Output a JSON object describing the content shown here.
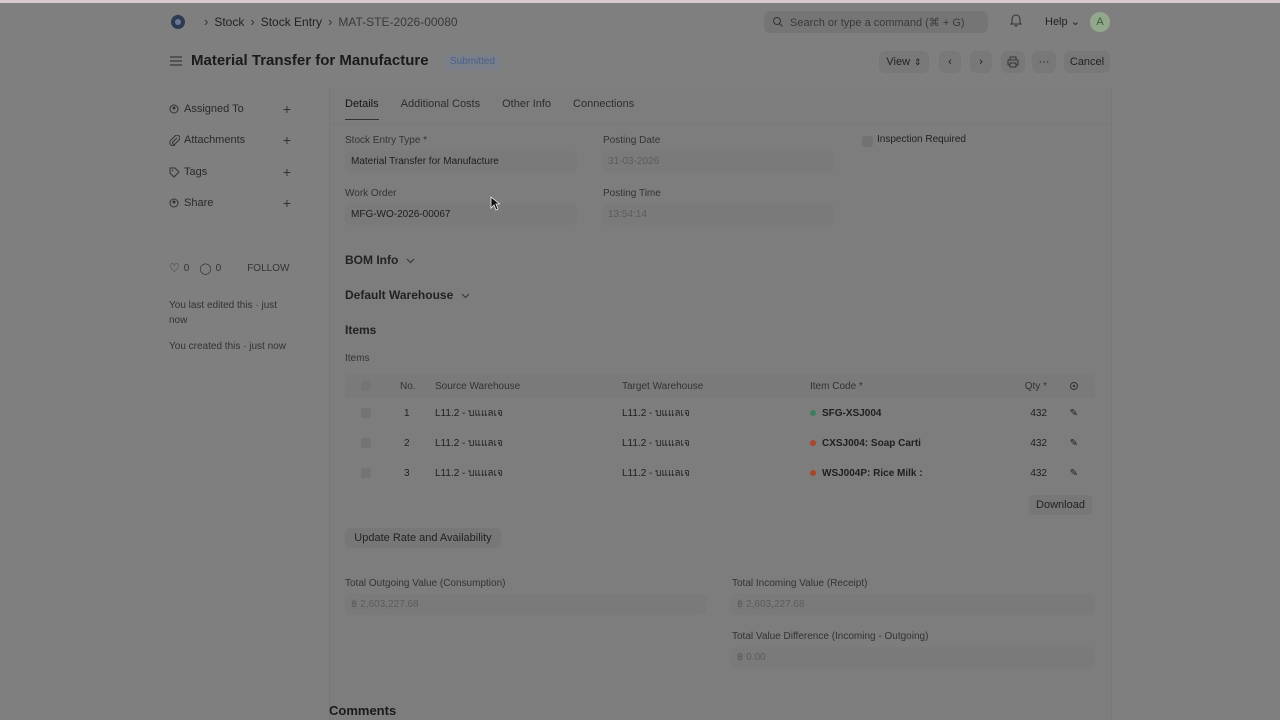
{
  "navbar": {
    "breadcrumbs": [
      "Stock",
      "Stock Entry",
      "MAT-STE-2026-00080"
    ],
    "search_placeholder": "Search or type a command (⌘ + G)",
    "help_label": "Help",
    "avatar_initial": "A"
  },
  "header": {
    "title": "Material Transfer for Manufacture",
    "status": "Submitted",
    "view_label": "View",
    "more_label": "···",
    "cancel_label": "Cancel"
  },
  "sidebar": {
    "items": [
      {
        "label": "Assigned To",
        "icon": "assign-icon"
      },
      {
        "label": "Attachments",
        "icon": "paperclip-icon"
      },
      {
        "label": "Tags",
        "icon": "tag-icon"
      },
      {
        "label": "Share",
        "icon": "share-icon"
      }
    ],
    "likes": "0",
    "comments": "0",
    "follow_label": "FOLLOW",
    "last_edited": "You last edited this · just now",
    "created": "You created this · just now"
  },
  "tabs": [
    "Details",
    "Additional Costs",
    "Other Info",
    "Connections"
  ],
  "form": {
    "stock_entry_type_label": "Stock Entry Type *",
    "stock_entry_type": "Material Transfer for Manufacture",
    "posting_date_label": "Posting Date",
    "posting_date": "31-03-2026",
    "inspection_label": "Inspection Required",
    "work_order_label": "Work Order",
    "work_order": "MFG-WO-2026-00067",
    "posting_time_label": "Posting Time",
    "posting_time": "13:54:14"
  },
  "sections": {
    "bom_info": "BOM Info",
    "default_warehouse": "Default Warehouse",
    "items": "Items",
    "items_sub": "Items"
  },
  "table": {
    "headers": {
      "no": "No.",
      "source": "Source Warehouse",
      "target": "Target Warehouse",
      "item_code": "Item Code *",
      "qty": "Qty *"
    },
    "rows": [
      {
        "no": "1",
        "source": "L11.2 - บแแลเจ",
        "target": "L11.2 - บแแลเจ",
        "item_code": "SFG-XSJ004",
        "dot": "#3f7d5a",
        "qty": "432"
      },
      {
        "no": "2",
        "source": "L11.2 - บแแลเจ",
        "target": "L11.2 - บแแลเจ",
        "item_code": "CXSJ004: Soap Carti",
        "dot": "#a8462a",
        "qty": "432"
      },
      {
        "no": "3",
        "source": "L11.2 - บแแลเจ",
        "target": "L11.2 - บแแลเจ",
        "item_code": "WSJ004P: Rice Milk :",
        "dot": "#a8462a",
        "qty": "432"
      }
    ],
    "download_label": "Download"
  },
  "update_rate_label": "Update Rate and Availability",
  "totals": {
    "outgoing_label": "Total Outgoing Value (Consumption)",
    "outgoing": "฿ 2,603,227.68",
    "incoming_label": "Total Incoming Value (Receipt)",
    "incoming": "฿ 2,603,227.68",
    "diff_label": "Total Value Difference (Incoming - Outgoing)",
    "diff": "฿ 0.00"
  },
  "comments_heading": "Comments"
}
